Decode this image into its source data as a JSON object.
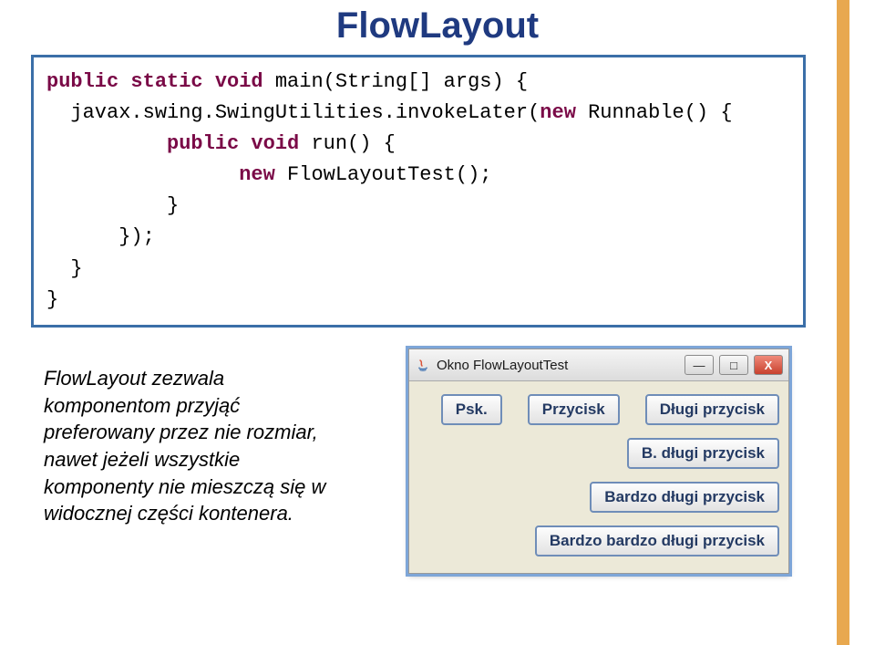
{
  "title": "FlowLayout",
  "code": {
    "l1a": "public static void",
    "l1b": " main(String[] args) {",
    "l2": "  javax.swing.SwingUtilities.invokeLater(",
    "l2kw": "new",
    "l2b": " Runnable() {",
    "l3a": "          public void",
    "l3b": " run() {",
    "l4a": "                ",
    "l4kw": "new",
    "l4b": " FlowLayoutTest();",
    "l5": "          }",
    "l6": "      });",
    "l7": "  }",
    "l8": "}"
  },
  "description": "FlowLayout zezwala komponentom przyjąć preferowany przez nie rozmiar, nawet jeżeli wszystkie komponenty nie mieszczą się w widocznej części kontenera.",
  "window": {
    "title": "Okno FlowLayoutTest",
    "min": "—",
    "max": "□",
    "close": "X",
    "buttons": {
      "b1": "Psk.",
      "b2": "Przycisk",
      "b3": "Długi przycisk",
      "b4": "B. długi przycisk",
      "b5": "Bardzo długi przycisk",
      "b6": "Bardzo bardzo długi przycisk"
    }
  }
}
